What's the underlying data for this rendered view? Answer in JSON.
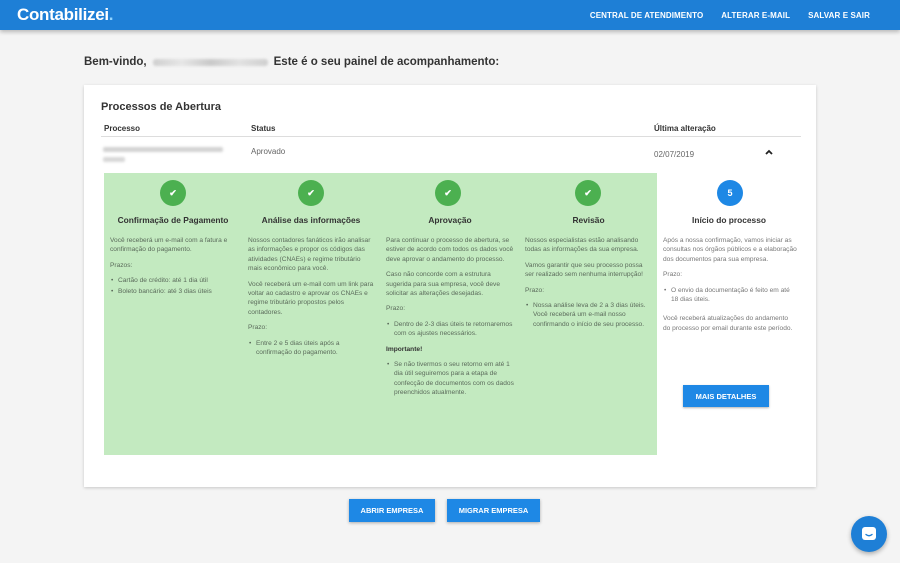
{
  "header": {
    "logo_text": "Contabilizei",
    "logo_dot": ".",
    "nav": [
      "CENTRAL DE ATENDIMENTO",
      "ALTERAR E-MAIL",
      "SALVAR E SAIR"
    ]
  },
  "welcome": {
    "prefix": "Bem-vindo,",
    "suffix": "Este é o seu painel de acompanhamento:"
  },
  "card": {
    "title": "Processos de Abertura",
    "columns": {
      "process": "Processo",
      "status": "Status",
      "last_change": "Última alteração"
    },
    "row": {
      "status": "Aprovado",
      "date": "02/07/2019"
    }
  },
  "steps": [
    {
      "marker": "✔",
      "title": "Confirmação de Pagamento",
      "paragraphs": [
        "Você receberá um e-mail com a fatura e confirmação do pagamento.",
        "Prazos:"
      ],
      "bullets": [
        "Cartão de crédito: até 1 dia útil",
        "Boleto bancário: até 3 dias úteis"
      ]
    },
    {
      "marker": "✔",
      "title": "Análise das informações",
      "paragraphs": [
        "Nossos contadores fanáticos irão analisar as informações e propor os códigos das atividades (CNAEs) e regime tributário mais econômico para você.",
        "Você receberá um e-mail com um link para voltar ao cadastro e aprovar os CNAEs e regime tributário propostos pelos contadores.",
        "Prazo:"
      ],
      "bullets": [
        "Entre 2 e 5 dias úteis após a confirmação do pagamento."
      ]
    },
    {
      "marker": "✔",
      "title": "Aprovação",
      "paragraphs": [
        "Para continuar o processo de abertura, se estiver de acordo com todos os dados você deve aprovar o andamento do processo.",
        "Caso não concorde com a estrutura sugerida para sua empresa, você deve solicitar as alterações desejadas.",
        "Prazo:"
      ],
      "bullets": [
        "Dentro de 2-3 dias úteis te retornaremos com os ajustes necessários."
      ],
      "important_label": "Importante!",
      "important_bullets": [
        "Se não tivermos o seu retorno em até 1 dia útil seguiremos para a etapa de confecção de documentos com os dados preenchidos atualmente."
      ]
    },
    {
      "marker": "✔",
      "title": "Revisão",
      "paragraphs": [
        "Nossos especialistas estão analisando todas as informações da sua empresa.",
        "Vamos garantir que seu processo possa ser realizado sem nenhuma interrupção!",
        "Prazo:"
      ],
      "bullets": [
        "Nossa análise leva de 2 a 3 dias úteis. Você receberá um e-mail nosso confirmando o início de seu processo."
      ]
    },
    {
      "marker": "5",
      "title": "Início do processo",
      "paragraphs": [
        "Após a nossa confirmação, vamos iniciar as consultas nos órgãos públicos e a elaboração dos documentos para sua empresa.",
        "Prazo:"
      ],
      "bullets": [
        "O envio da documentação é feito em até 18 dias úteis."
      ],
      "after": "Você receberá atualizações do andamento do processo por email durante este período.",
      "button": "MAIS DETALHES"
    }
  ],
  "actions": {
    "open_company": "ABRIR EMPRESA",
    "migrate_company": "MIGRAR EMPRESA"
  },
  "colors": {
    "primary": "#1e7fd6",
    "success": "#4cb050",
    "done_bg": "#c3eac0"
  },
  "icons": {
    "check": "check-icon",
    "chevron": "chevron-up-icon",
    "chat": "chat-icon"
  }
}
